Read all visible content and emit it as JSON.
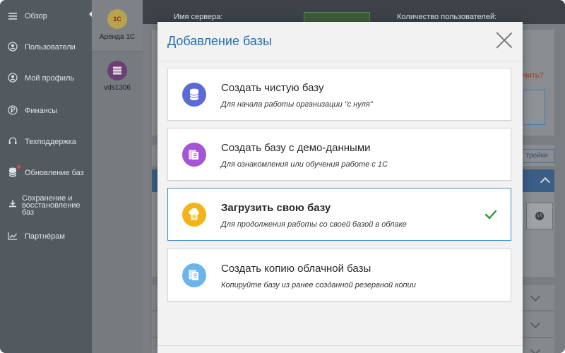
{
  "sidebar": {
    "items": [
      {
        "label": "Обзор",
        "icon": "menu-icon"
      },
      {
        "label": "Пользователи",
        "icon": "user-icon"
      },
      {
        "label": "Мой профиль",
        "icon": "profile-icon"
      },
      {
        "label": "Финансы",
        "icon": "ruble-icon"
      },
      {
        "label": "Техподдержка",
        "icon": "headset-icon"
      },
      {
        "label": "Обновление баз",
        "icon": "database-icon"
      },
      {
        "label_lines": [
          "Сохранение и",
          "восстановление",
          "баз"
        ],
        "icon": "download-icon"
      },
      {
        "label": "Партнёрам",
        "icon": "chart-icon"
      }
    ]
  },
  "apps": [
    {
      "label": "Аренда 1С",
      "logo_text": "1С"
    },
    {
      "label": "vds1306"
    }
  ],
  "background": {
    "server_name_label": "Имя сервера:",
    "user_count_label": "Количество пользователей:",
    "link_fragment": "очить?",
    "settings_fragment": "тройки"
  },
  "modal": {
    "title": "Добавление базы",
    "options": [
      {
        "title": "Создать чистую базу",
        "description": "Для начала работы организации \"с нуля\"",
        "icon": "database-icon",
        "color": "#5b6ad6",
        "selected": false
      },
      {
        "title": "Создать базу с демо-данными",
        "description": "Для ознакомления или обучения работе с 1С",
        "icon": "documents-icon",
        "color": "#a355d6",
        "selected": false
      },
      {
        "title": "Загрузить свою базу",
        "description": "Для продолжения работы со своей базой в облаке",
        "icon": "cloud-upload-icon",
        "color": "#f2b418",
        "selected": true
      },
      {
        "title": "Создать копию облачной базы",
        "description": "Копируйте базу из ранее созданной резервной копии",
        "icon": "copy-icon",
        "color": "#6bb5ea",
        "selected": false
      }
    ]
  },
  "colors": {
    "accent": "#1f6fb2",
    "selected_border": "#3a8fd1",
    "check": "#2b9a35"
  }
}
